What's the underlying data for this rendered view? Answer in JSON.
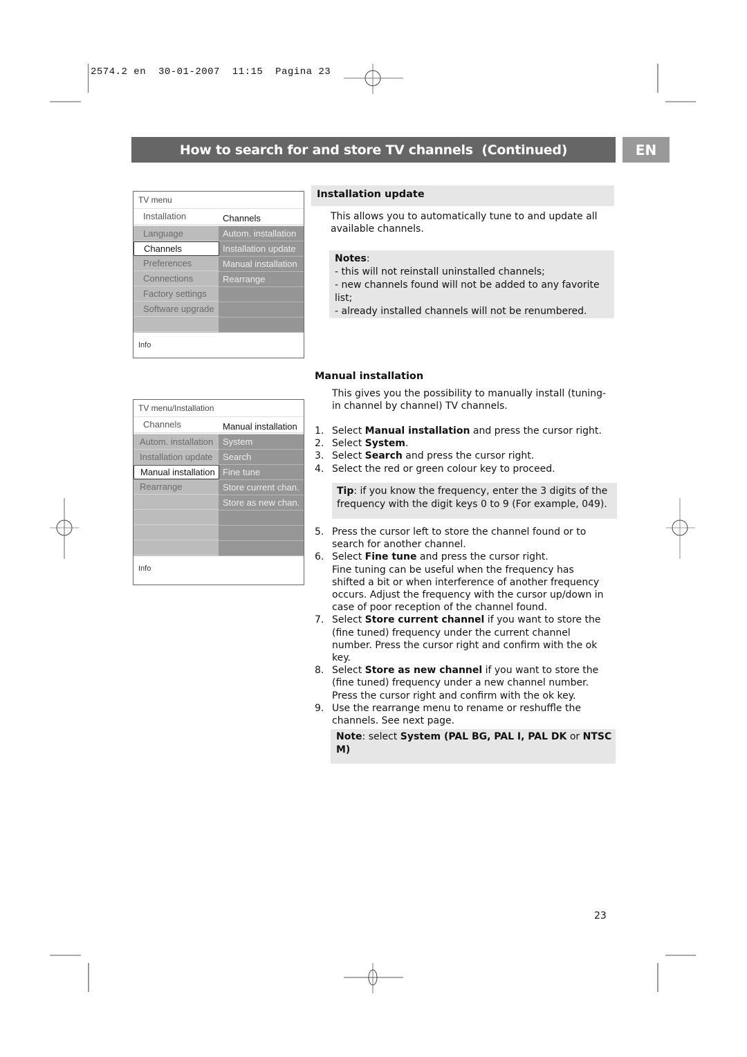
{
  "print_header": {
    "job": "2574.2 en",
    "date": "30-01-2007",
    "time": "11:15",
    "page_label": "Pagina 23"
  },
  "title_bar": {
    "title": "How to search for and store TV channels  (Continued)",
    "language_badge": "EN",
    "colors": {
      "title_bg": "#666666",
      "badge_bg": "#999999",
      "text": "#ffffff"
    }
  },
  "tv_menu_1": {
    "header": "TV menu",
    "sub_left": "Installation",
    "sub_right": "Channels",
    "left_items": [
      {
        "label": "Language",
        "selected": false
      },
      {
        "label": "Channels",
        "selected": true
      },
      {
        "label": "Preferences",
        "selected": false
      },
      {
        "label": "Connections",
        "selected": false
      },
      {
        "label": "Factory settings",
        "selected": false
      },
      {
        "label": "Software upgrade",
        "selected": false
      },
      {
        "label": "",
        "selected": false
      }
    ],
    "right_items": [
      "Autom. installation",
      "Installation update",
      "Manual installation",
      "Rearrange",
      "",
      "",
      ""
    ],
    "info": "Info"
  },
  "tv_menu_2": {
    "header": "TV menu/Installation",
    "sub_left": "Channels",
    "sub_right": "Manual installation",
    "left_items": [
      {
        "label": "Autom. installation",
        "selected": false
      },
      {
        "label": "Installation update",
        "selected": false
      },
      {
        "label": "Manual installation",
        "selected": true
      },
      {
        "label": "Rearrange",
        "selected": false
      },
      {
        "label": "",
        "selected": false
      },
      {
        "label": "",
        "selected": false
      },
      {
        "label": "",
        "selected": false
      },
      {
        "label": "",
        "selected": false
      }
    ],
    "right_items": [
      "System",
      "Search",
      "Fine tune",
      "Store current chan.",
      "Store as new chan.",
      "",
      "",
      ""
    ],
    "info": "Info"
  },
  "installation_update": {
    "heading": "Installation update",
    "intro": "This allows you to automatically tune to and update all available channels.",
    "notes_label": "Notes",
    "notes": [
      "- this will not reinstall uninstalled channels;",
      "- new channels found will not be added to any favorite list;",
      "- already installed channels will not be renumbered."
    ]
  },
  "manual_installation": {
    "heading": "Manual installation",
    "intro": "This gives you the possibility to manually install (tuning-in channel by channel) TV channels.",
    "steps_a": [
      {
        "n": "1.",
        "pre": "Select ",
        "bold": "Manual installation",
        "post": " and press the cursor right."
      },
      {
        "n": "2.",
        "pre": "Select ",
        "bold": "System",
        "post": "."
      },
      {
        "n": "3.",
        "pre": "Select ",
        "bold": "Search",
        "post": " and press the cursor right."
      },
      {
        "n": "4.",
        "pre": "Select the red or green colour key to proceed.",
        "bold": "",
        "post": ""
      }
    ],
    "tip_label": "Tip",
    "tip_text": ": if you know the frequency, enter the 3 digits of the frequency with the digit keys 0 to 9 (For example, 049).",
    "steps_b": [
      {
        "n": "5.",
        "pre": "Press the cursor left to store the channel found or to search for another channel.",
        "bold": "",
        "post": ""
      },
      {
        "n": "6.",
        "pre": "Select ",
        "bold": "Fine tune",
        "post": " and press the cursor right.",
        "extra": "Fine tuning can be useful when the frequency has shifted a bit or when interference of another frequency occurs. Adjust the frequency with the cursor up/down in case of poor reception of the channel found."
      },
      {
        "n": "7.",
        "pre": "Select ",
        "bold": "Store current channel",
        "post": " if you want to store the (fine tuned) frequency under the current channel number. Press the cursor right and confirm with the ok key."
      },
      {
        "n": "8.",
        "pre": "Select ",
        "bold": "Store as new channel",
        "post": " if you want to store the (fine tuned) frequency under a new channel number. Press the cursor right and confirm with the ok key."
      },
      {
        "n": "9.",
        "pre": "Use the rearrange menu to rename or reshuffle the channels. See next page.",
        "bold": "",
        "post": ""
      }
    ],
    "note_label": "Note",
    "note_pre": ": select ",
    "note_bold1": "System (PAL BG, PAL I, PAL DK",
    "note_mid": " or ",
    "note_bold2": "NTSC M)"
  },
  "page_number": "23"
}
